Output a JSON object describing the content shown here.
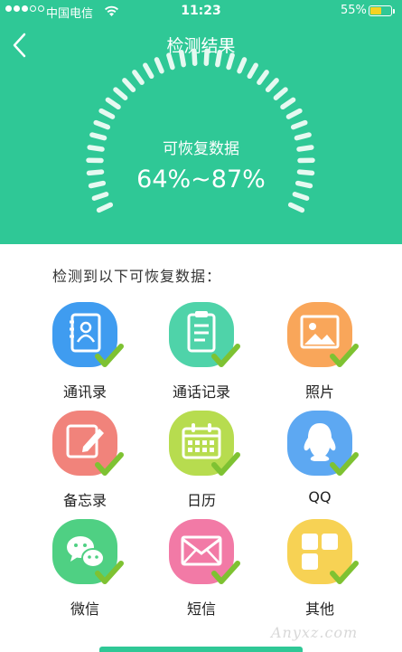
{
  "status_bar": {
    "carrier": "中国电信",
    "time": "11:23",
    "battery": "55%",
    "battery_level": 0.55
  },
  "nav": {
    "title": "检测结果"
  },
  "result": {
    "label": "可恢复数据",
    "value": "64%~87%"
  },
  "section": {
    "title": "检测到以下可恢复数据："
  },
  "items": [
    {
      "label": "通讯录",
      "icon": "contacts-icon",
      "color": "#3f9cf0"
    },
    {
      "label": "通话记录",
      "icon": "call-log-icon",
      "color": "#4fd3a9"
    },
    {
      "label": "照片",
      "icon": "photo-icon",
      "color": "#f9a65a"
    },
    {
      "label": "备忘录",
      "icon": "memo-icon",
      "color": "#f1837b"
    },
    {
      "label": "日历",
      "icon": "calendar-icon",
      "color": "#b7dc4f"
    },
    {
      "label": "QQ",
      "icon": "qq-icon",
      "color": "#5da8f2"
    },
    {
      "label": "微信",
      "icon": "wechat-icon",
      "color": "#4fd083"
    },
    {
      "label": "短信",
      "icon": "sms-icon",
      "color": "#f27aa6"
    },
    {
      "label": "其他",
      "icon": "other-icon",
      "color": "#f7d254"
    }
  ],
  "colors": {
    "brand": "#2fc896",
    "check": "#7ec232"
  },
  "watermark": "Anyxz.com"
}
